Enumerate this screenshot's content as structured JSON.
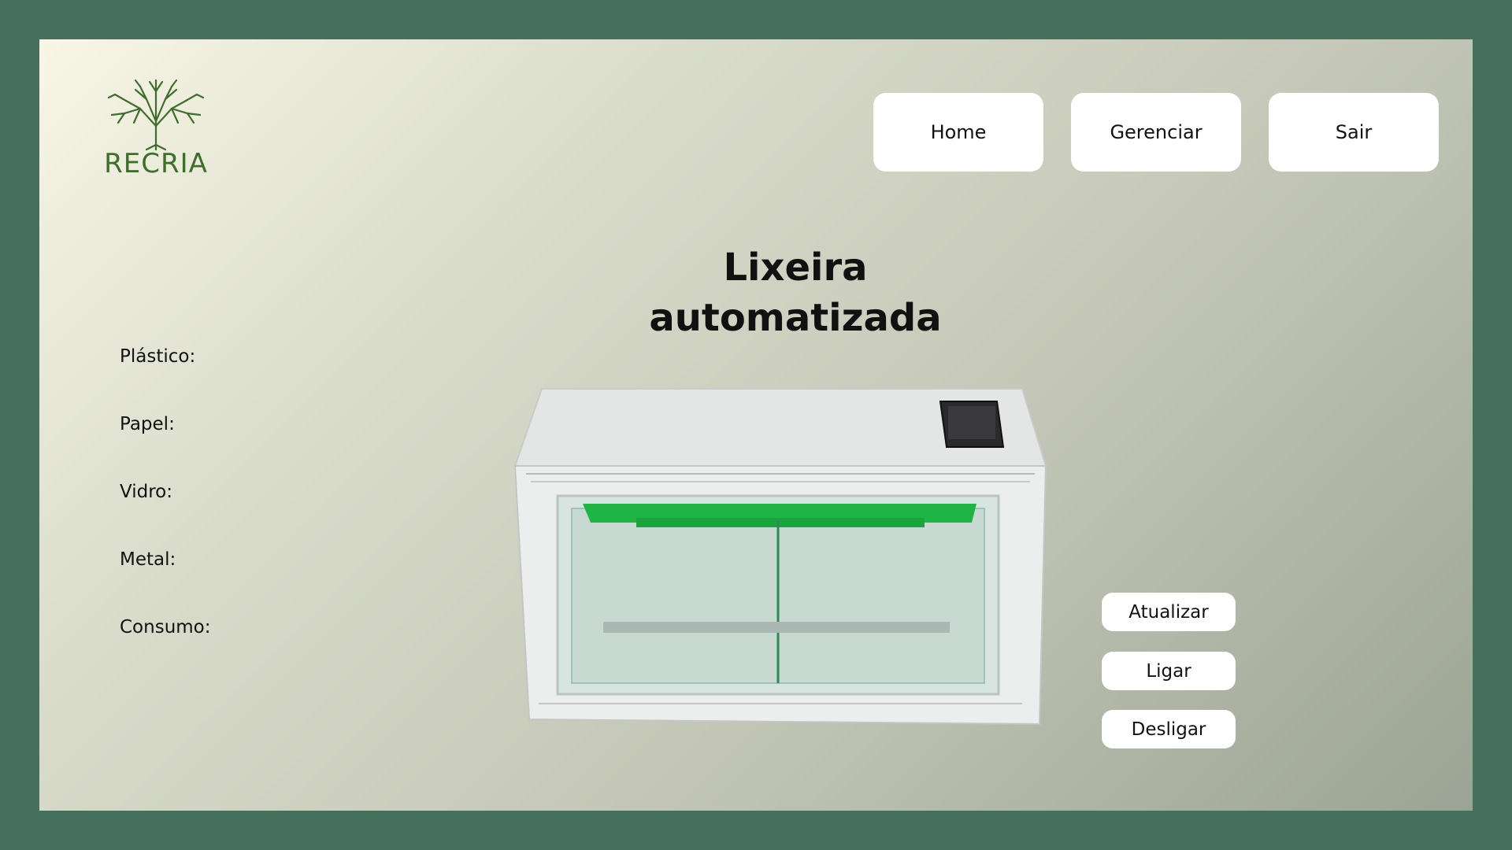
{
  "brand": {
    "name": "RECRIA",
    "color": "#3f6d2c"
  },
  "nav": {
    "home": "Home",
    "manage": "Gerenciar",
    "exit": "Sair"
  },
  "page": {
    "title_line1": "Lixeira",
    "title_line2": "automatizada"
  },
  "stats": [
    {
      "label": "Plástico:"
    },
    {
      "label": "Papel:"
    },
    {
      "label": "Vidro:"
    },
    {
      "label": "Metal:"
    },
    {
      "label": "Consumo:"
    }
  ],
  "actions": {
    "update": "Atualizar",
    "on": "Ligar",
    "off": "Desligar"
  },
  "colors": {
    "frame": "#45705e",
    "button_bg": "#ffffff",
    "accent_green": "#1fb545"
  }
}
